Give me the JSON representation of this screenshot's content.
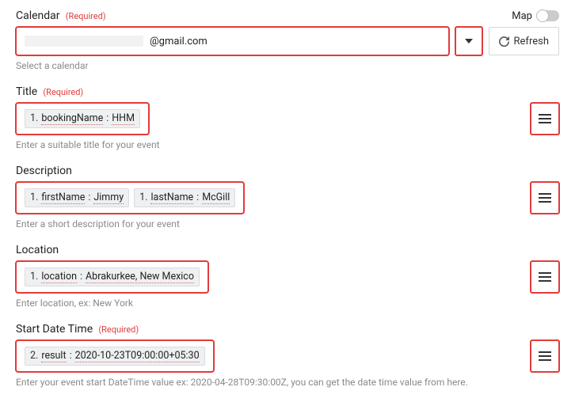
{
  "calendar": {
    "label": "Calendar",
    "required": "(Required)",
    "map_label": "Map",
    "value_suffix": "@gmail.com",
    "helper": "Select a calendar",
    "refresh_label": "Refresh"
  },
  "title": {
    "label": "Title",
    "required": "(Required)",
    "token": {
      "idx": "1.",
      "key": "bookingName",
      "sep": ":",
      "val": "HHM"
    },
    "helper": "Enter a suitable title for your event"
  },
  "description": {
    "label": "Description",
    "token1": {
      "idx": "1.",
      "key": "firstName",
      "sep": ":",
      "val": "Jimmy"
    },
    "token2": {
      "idx": "1.",
      "key": "lastName",
      "sep": ":",
      "val": "McGill"
    },
    "helper": "Enter a short description for your event"
  },
  "location": {
    "label": "Location",
    "token": {
      "idx": "1.",
      "key": "location",
      "sep": ":",
      "val": "Abrakurkee, New Mexico"
    },
    "helper": "Enter location, ex: New York"
  },
  "start": {
    "label": "Start Date Time",
    "required": "(Required)",
    "token": {
      "idx": "2.",
      "key": "result",
      "sep": ":",
      "val": "2020-10-23T09:00:00+05:30"
    },
    "helper": "Enter your event start DateTime value ex: 2020-04-28T09:30:00Z, you can get the date time value from here."
  }
}
